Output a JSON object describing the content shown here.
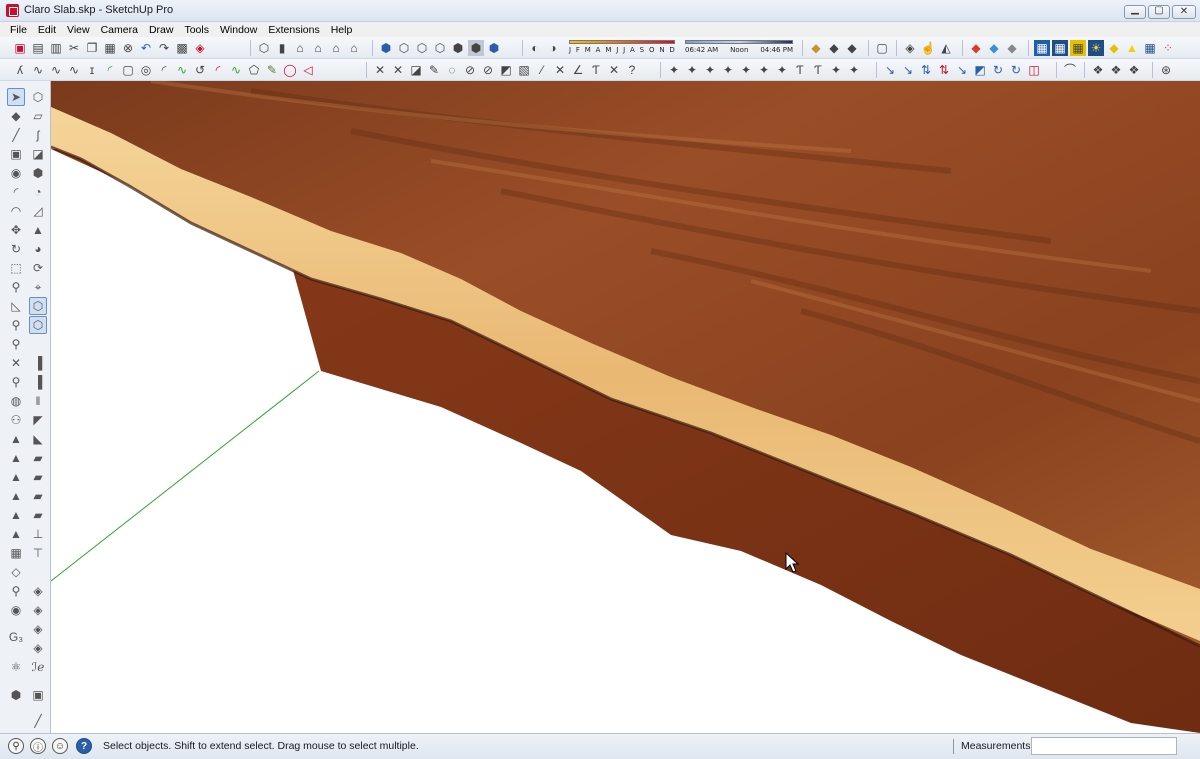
{
  "window": {
    "title": "Claro Slab.skp - SketchUp Pro"
  },
  "menu": [
    "File",
    "Edit",
    "View",
    "Camera",
    "Draw",
    "Tools",
    "Window",
    "Extensions",
    "Help"
  ],
  "shadow": {
    "months": [
      "J",
      "F",
      "M",
      "A",
      "M",
      "J",
      "J",
      "A",
      "S",
      "O",
      "N",
      "D"
    ],
    "time_start": "06:42 AM",
    "time_mid": "Noon",
    "time_end": "04:46 PM"
  },
  "status": {
    "message": "Select objects. Shift to extend select. Drag mouse to select multiple.",
    "measurements_label": "Measurements",
    "measurements_value": ""
  },
  "colors": {
    "slab_top": "#8a3e1f",
    "slab_edge": "#f2c98a",
    "slab_side": "#7a3217",
    "green_axis": "#2ea52e",
    "accent_red": "#c8102e"
  }
}
